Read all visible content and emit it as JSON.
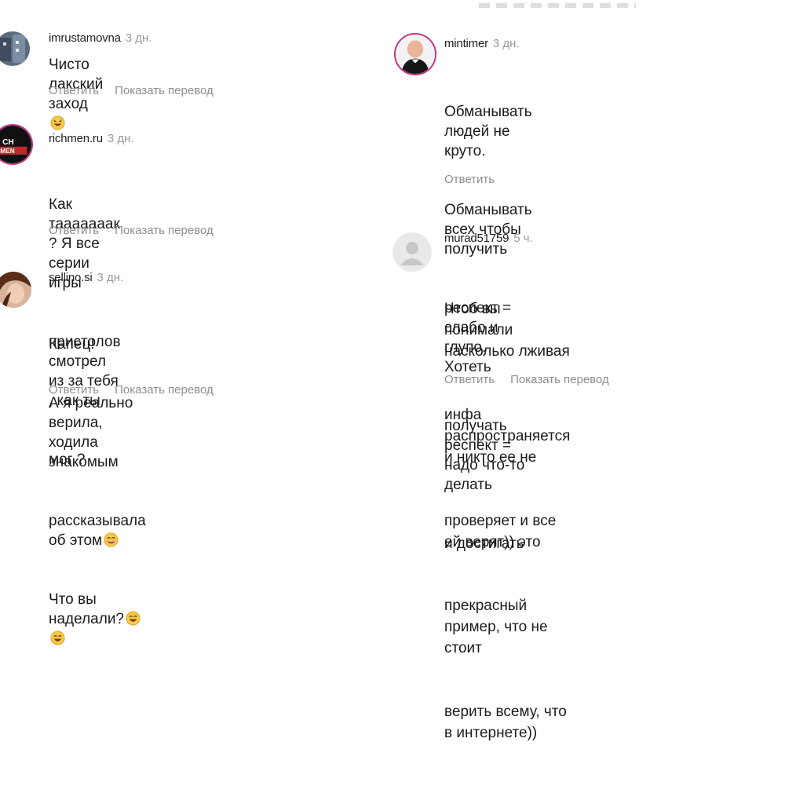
{
  "comments_left": [
    {
      "username": "imrustamovna",
      "time": "3 дн.",
      "lines": [
        "Чисто лакский заход"
      ],
      "emoji_after_text": [
        "grinning-sweat-emoji"
      ],
      "reply_label": "Ответить",
      "translate_label": "Показать перевод"
    },
    {
      "username": "richmen.ru",
      "time": "3 дн.",
      "lines": [
        "Как таааааaак ? Я все серии игры",
        "пристолов смотрел из за тебя , как ты",
        "мог ?"
      ],
      "reply_label": "Ответить",
      "translate_label": "Показать перевод"
    },
    {
      "username": "sellino.si",
      "time": "3 дн.",
      "lines": [
        "Капец!",
        "А я реально верила, ходила знакомым",
        "рассказывала об этом",
        "Что вы наделали?"
      ],
      "reply_label": "Ответить",
      "translate_label": "Показать перевод"
    }
  ],
  "comments_right": [
    {
      "username": "mintimer",
      "time": "3 дн.",
      "lines": [
        "Обманывать людей не круто.",
        "Обманывать всех чтобы получить",
        "респект = слабо и глупо. Хотеть",
        "получать респект = надо что-то делать",
        "и достигать"
      ],
      "reply_label": "Ответить"
    },
    {
      "username": "murad51759",
      "time": "5 ч.",
      "lines": [
        "Чтоб вы понимали насколько лживая",
        "инфа распространяется и никто ее не",
        "проверяет и все ей верят)) это",
        "прекрасный пример, что не стоит",
        "верить всему, что в интернете))"
      ],
      "reply_label": "Ответить",
      "translate_label": "Показать перевод"
    }
  ],
  "avatar_logo_text": [
    "CH",
    "MEN"
  ],
  "colors": {
    "muted": "#8e8e8e",
    "story_ring": "#c13584",
    "placeholder_avatar": "#c7c7c7"
  }
}
